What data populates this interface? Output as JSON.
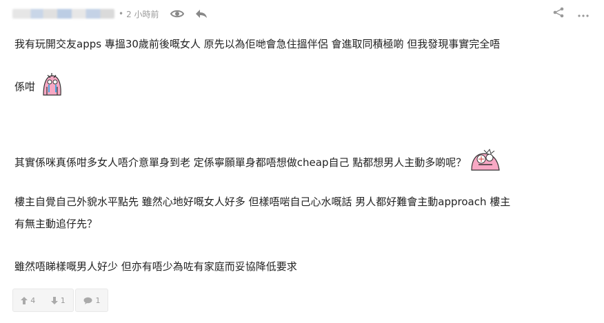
{
  "post": {
    "time": "2 小時前",
    "paragraphs": [
      "我有玩開交友apps 專搵30歲前後嘅女人 原先以為佢哋會急住搵伴侶 會進取同積極啲 但我發現事實完全唔",
      "係咁",
      "其實係咪真係咁多女人唔介意單身到老 定係寧願單身都唔想做cheap自己 點都想男人主動多啲呢？",
      "樓主自覺自己外貌水平點先 雖然心地好嘅女人好多 但樣唔啱自己心水嘅話 男人都好難會主動approach 樓主",
      "有無主動追仔先？",
      "雖然唔睇樣嘅男人好少 但亦有唔少為咗有家庭而妥協降低要求"
    ]
  },
  "actions": {
    "upvotes": "4",
    "downvotes": "1",
    "replies": "1"
  },
  "icons": {
    "view": "eye-icon",
    "reply": "reply-arrow-icon",
    "share": "share-icon",
    "more": "more-icon"
  }
}
